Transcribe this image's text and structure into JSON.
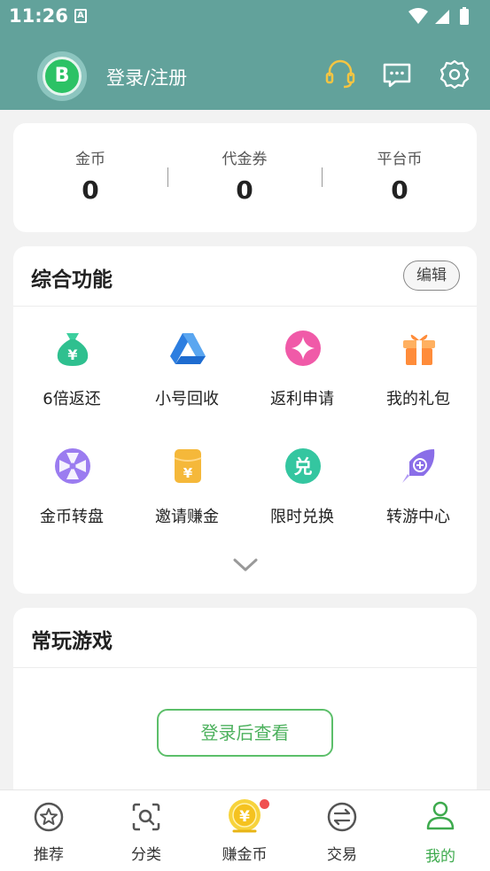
{
  "status": {
    "time": "11:26",
    "app_icon_letter": "A"
  },
  "header": {
    "login_label": "登录/注册",
    "avatar_letter": "B",
    "accent": "#62a29b"
  },
  "wallet": {
    "items": [
      {
        "label": "金币",
        "value": "0"
      },
      {
        "label": "代金券",
        "value": "0"
      },
      {
        "label": "平台币",
        "value": "0"
      }
    ]
  },
  "features": {
    "title": "综合功能",
    "edit_label": "编辑",
    "items": [
      {
        "label": "6倍返还",
        "icon": "money-bag-icon"
      },
      {
        "label": "小号回收",
        "icon": "triangle-recycle-icon"
      },
      {
        "label": "返利申请",
        "icon": "sparkle-icon"
      },
      {
        "label": "我的礼包",
        "icon": "gift-icon"
      },
      {
        "label": "金币转盘",
        "icon": "wheel-icon"
      },
      {
        "label": "邀请赚金",
        "icon": "envelope-icon"
      },
      {
        "label": "限时兑换",
        "icon": "exchange-icon"
      },
      {
        "label": "转游中心",
        "icon": "rocket-icon"
      }
    ]
  },
  "recent": {
    "title": "常玩游戏",
    "login_view_label": "登录后查看"
  },
  "tabs": [
    {
      "label": "推荐",
      "icon": "star-icon"
    },
    {
      "label": "分类",
      "icon": "search-category-icon"
    },
    {
      "label": "赚金币",
      "icon": "coin-icon"
    },
    {
      "label": "交易",
      "icon": "trade-icon"
    },
    {
      "label": "我的",
      "icon": "user-icon"
    }
  ]
}
